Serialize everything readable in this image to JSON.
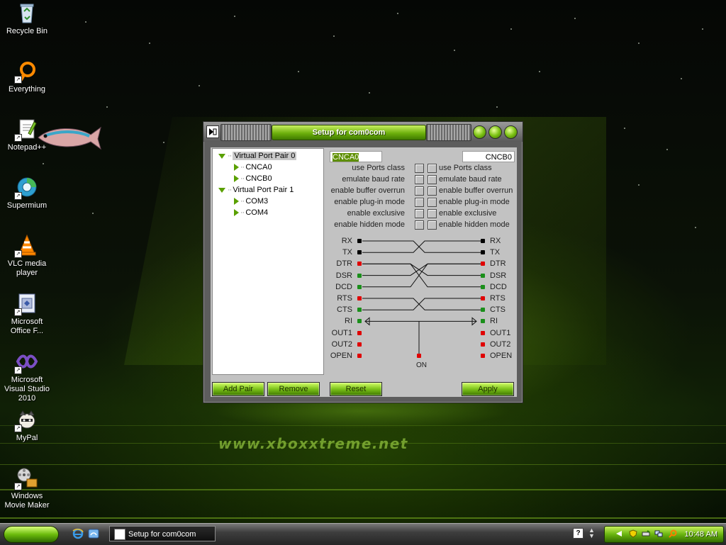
{
  "desktop": {
    "watermark": "www.xboxxtreme.net",
    "icons": [
      {
        "label": "Recycle Bin",
        "icon": "recycle-bin-icon"
      },
      {
        "label": "Everything",
        "icon": "everything-search-icon"
      },
      {
        "label": "Notepad++",
        "icon": "notepad-plus-plus-icon"
      },
      {
        "label": "Supermium",
        "icon": "supermium-browser-icon"
      },
      {
        "label": "VLC media player",
        "icon": "vlc-cone-icon"
      },
      {
        "label": "Microsoft Office F...",
        "icon": "office-file-icon"
      },
      {
        "label": "Microsoft Visual Studio 2010",
        "icon": "visual-studio-icon"
      },
      {
        "label": "MyPal",
        "icon": "mypal-browser-icon"
      },
      {
        "label": "Windows Movie Maker",
        "icon": "movie-maker-icon"
      }
    ]
  },
  "window": {
    "title": "Setup for com0com",
    "tree": {
      "pairs": [
        {
          "label": "Virtual Port Pair 0",
          "children": [
            "CNCA0",
            "CNCB0"
          ],
          "selected": true
        },
        {
          "label": "Virtual Port Pair 1",
          "children": [
            "COM3",
            "COM4"
          ],
          "selected": false
        }
      ]
    },
    "port_a": "CNCA0",
    "port_b": "CNCB0",
    "options": [
      {
        "label": "use Ports class",
        "a": false,
        "b": false
      },
      {
        "label": "emulate baud rate",
        "a": false,
        "b": false
      },
      {
        "label": "enable buffer overrun",
        "a": false,
        "b": false
      },
      {
        "label": "enable plug-in mode",
        "a": false,
        "b": false
      },
      {
        "label": "enable exclusive",
        "a": false,
        "b": false
      },
      {
        "label": "enable hidden mode",
        "a": false,
        "b": false
      }
    ],
    "signals_left": [
      "RX",
      "TX",
      "DTR",
      "DSR",
      "DCD",
      "RTS",
      "CTS",
      "RI",
      "OUT1",
      "OUT2",
      "OPEN"
    ],
    "signals_right": [
      "RX",
      "TX",
      "DTR",
      "DSR",
      "DCD",
      "RTS",
      "CTS",
      "RI",
      "OUT1",
      "OUT2",
      "OPEN"
    ],
    "signal_colors": {
      "RX": "#000000",
      "TX": "#000000",
      "DTR": "#e00000",
      "DSR": "#1a8f1a",
      "DCD": "#1a8f1a",
      "RTS": "#e00000",
      "CTS": "#1a8f1a",
      "RI": "#1a8f1a",
      "OUT1": "#e00000",
      "OUT2": "#e00000",
      "OPEN": "#e00000"
    },
    "on_label": "ON",
    "buttons": {
      "add_pair": "Add Pair",
      "remove": "Remove",
      "reset": "Reset",
      "apply": "Apply"
    }
  },
  "taskbar": {
    "task_item": "Setup for com0com",
    "clock": "10:48 AM",
    "help": "?"
  },
  "colors": {
    "accent": "#6cbc0c",
    "window_bg": "#c2c2c2",
    "frame": "#5d5d5d"
  }
}
